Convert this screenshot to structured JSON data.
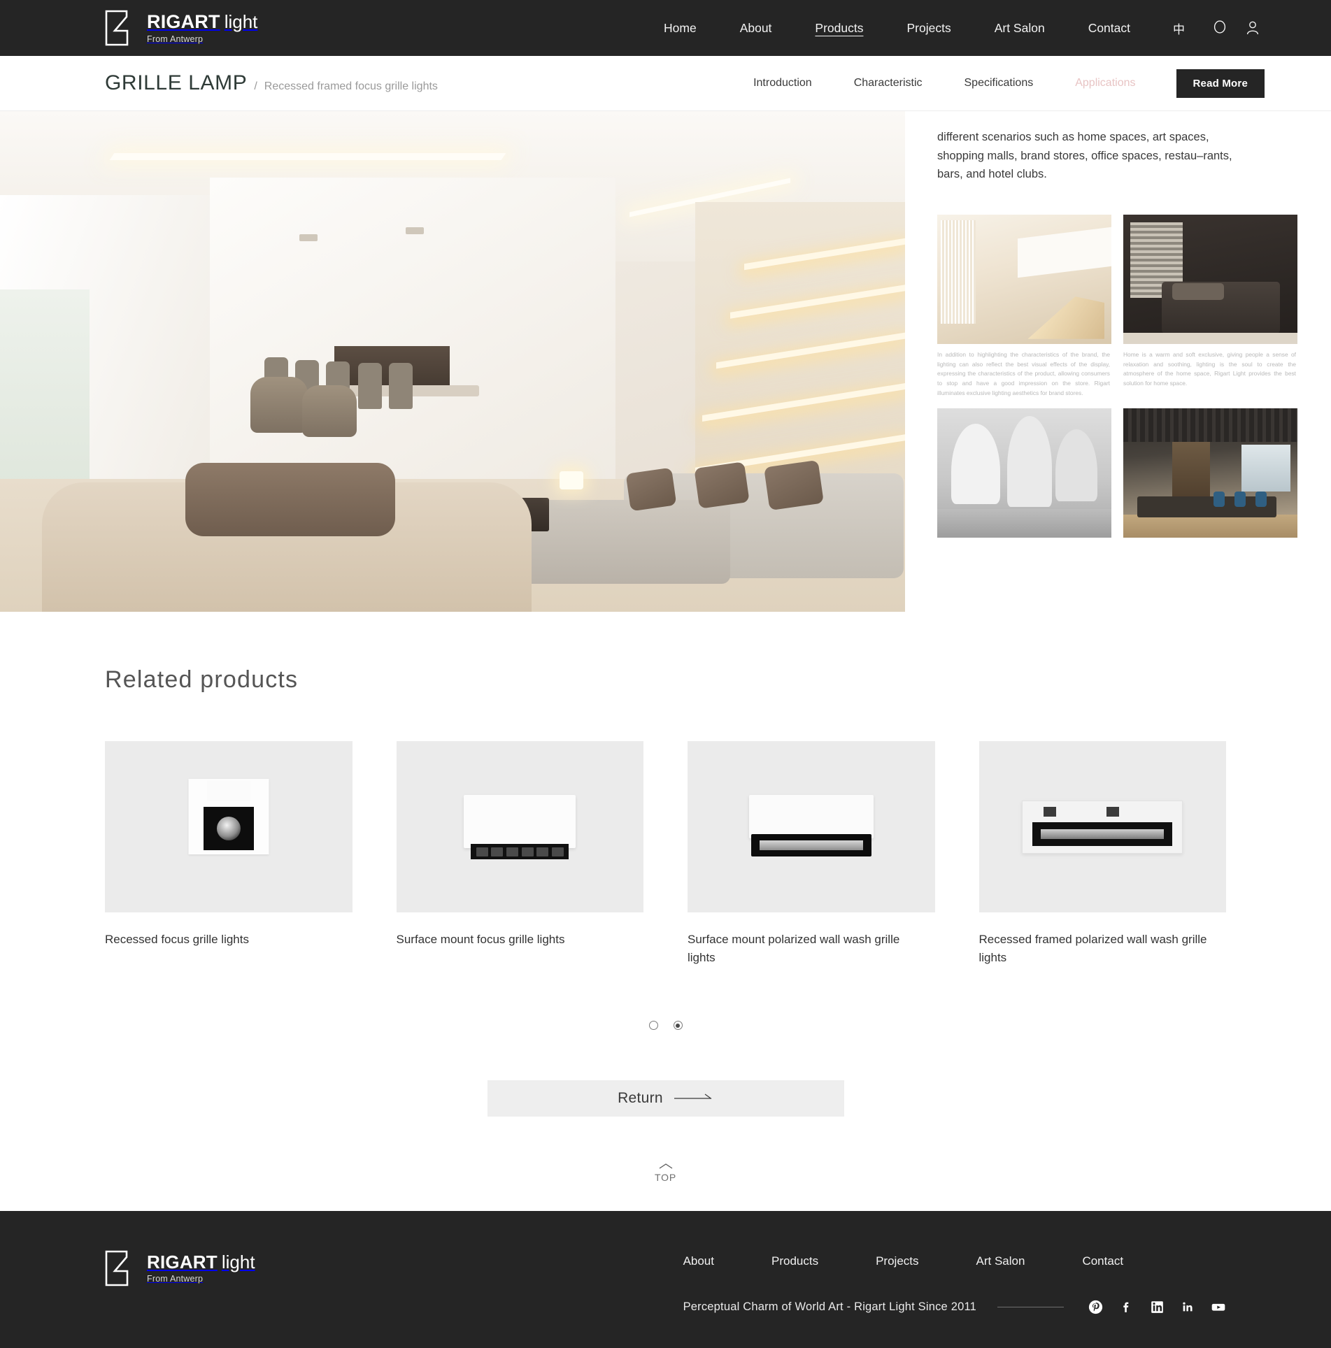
{
  "brand": {
    "name_bold": "RIGART",
    "name_light": "light",
    "tagline": "From Antwerp",
    "logo_icon": "rigart-r-monogram"
  },
  "topnav": {
    "items": [
      {
        "label": "Home",
        "active": false
      },
      {
        "label": "About",
        "active": false
      },
      {
        "label": "Products",
        "active": true
      },
      {
        "label": "Projects",
        "active": false
      },
      {
        "label": "Art Salon",
        "active": false
      },
      {
        "label": "Contact",
        "active": false
      }
    ],
    "lang_toggle": "中",
    "search_icon": "search-icon",
    "account_icon": "user-icon"
  },
  "product_bar": {
    "title": "GRILLE LAMP",
    "separator": "/",
    "subtitle": "Recessed framed focus grille lights",
    "tabs": [
      {
        "label": "Introduction",
        "active": false
      },
      {
        "label": "Characteristic",
        "active": false
      },
      {
        "label": "Specifications",
        "active": false
      },
      {
        "label": "Applications",
        "active": true
      }
    ],
    "read_more": "Read More",
    "active_color": "#e8c4c4"
  },
  "hero": {
    "paragraph": "different scenarios such as home spaces, art spaces, shopping malls, brand stores, office spaces, restau–rants, bars, and hotel clubs.",
    "gallery": [
      {
        "name": "atrium-staircase-photo",
        "caption": "In addition to highlighting the characteristics of the brand, the lighting can also reflect the best visual effects of the display, expressing the characteristics of the product, allowing consumers to stop and have a good impression on the store. Rigart illuminates exclusive lighting aesthetics for brand stores."
      },
      {
        "name": "dark-bedroom-photo",
        "caption": "Home is a warm and soft exclusive, giving people a sense of relaxation and soothing, lighting is the soul to create the atmosphere of the home space, Rigart Light provides the best solution for home space."
      },
      {
        "name": "white-showroom-photo",
        "caption": ""
      },
      {
        "name": "office-interior-photo",
        "caption": ""
      }
    ]
  },
  "related": {
    "heading": "Related products",
    "items": [
      {
        "label": "Recessed focus grille lights",
        "image": "recessed-focus-grille-light-photo"
      },
      {
        "label": "Surface mount focus grille lights",
        "image": "surface-mount-focus-grille-light-photo"
      },
      {
        "label": "Surface mount polarized wall wash grille lights",
        "image": "surface-mount-polarized-wall-wash-light-photo"
      },
      {
        "label": "Recessed framed polarized wall wash grille lights",
        "image": "recessed-framed-polarized-wall-wash-light-photo"
      }
    ],
    "pagination": {
      "total": 2,
      "active_index": 1
    }
  },
  "actions": {
    "return_label": "Return",
    "return_icon": "long-right-arrow-icon",
    "top_label": "TOP",
    "top_icon": "chevron-up-icon"
  },
  "footer": {
    "nav": [
      {
        "label": "About"
      },
      {
        "label": "Products"
      },
      {
        "label": "Projects"
      },
      {
        "label": "Art Salon"
      },
      {
        "label": "Contact"
      }
    ],
    "tagline": "Perceptual Charm of World Art - Rigart Light Since 2011",
    "socials": [
      {
        "name": "pinterest-icon",
        "glyph": "P"
      },
      {
        "name": "facebook-icon",
        "glyph": "f"
      },
      {
        "name": "linkedin-icon",
        "glyph": "in"
      },
      {
        "name": "linkedin-alt-icon",
        "glyph": "in"
      },
      {
        "name": "youtube-icon",
        "glyph": "▶"
      }
    ]
  },
  "colors": {
    "dark": "#252525",
    "accent_pink": "#e8c4c4",
    "card_bg": "#ebebeb",
    "button_bg": "#eeeeee"
  }
}
